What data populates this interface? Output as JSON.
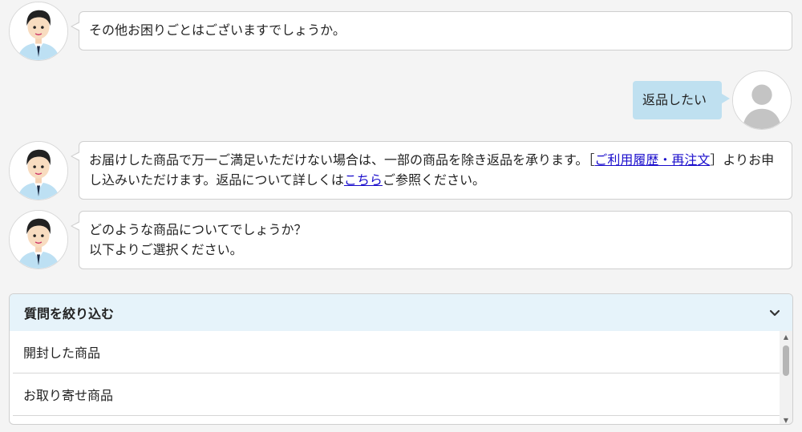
{
  "messages": [
    {
      "type": "bot",
      "lines": [
        "その他お困りごとはございますでしょうか。"
      ]
    },
    {
      "type": "user",
      "text": "返品したい"
    },
    {
      "type": "bot",
      "part1": "お届けした商品で万一ご満足いただけない場合は、一部の商品を除き返品を承ります。［",
      "link1": "ご利用履歴・再注文",
      "part2": "］よりお申し込みいただけます。返品について詳しくは",
      "link2": "こちら",
      "part3": "ご参照ください。"
    },
    {
      "type": "bot",
      "lines": [
        "どのような商品についてでしょうか？",
        "以下よりご選択ください。"
      ]
    }
  ],
  "filter_panel": {
    "title": "質問を絞り込む",
    "options": [
      "開封した商品",
      "お取り寄せ商品"
    ]
  },
  "colors": {
    "user_bubble": "#bfe0f0",
    "panel_header": "#e6f3fa",
    "link": "#1a0dcc"
  }
}
